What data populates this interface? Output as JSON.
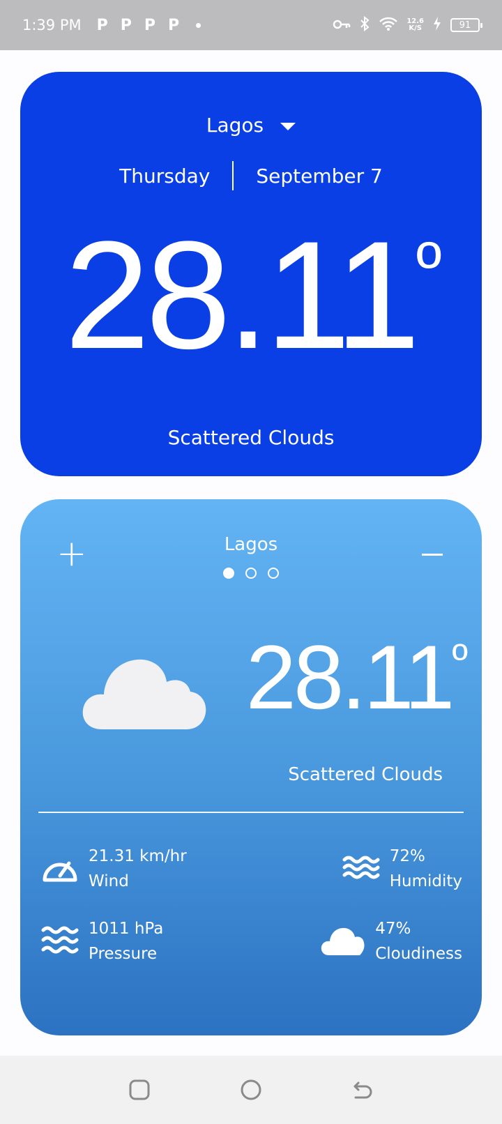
{
  "status_bar": {
    "time": "1:39 PM",
    "notification_icons": [
      "P",
      "P",
      "P",
      "P"
    ],
    "net_speed_value": "12.6",
    "net_speed_unit": "K/S",
    "battery": "91"
  },
  "main_card": {
    "city": "Lagos",
    "day": "Thursday",
    "date": "September 7",
    "temperature": "28.11",
    "degree_symbol": "º",
    "condition": "Scattered Clouds",
    "background_color": "#0a3fe6"
  },
  "detail_card": {
    "add_label": "+",
    "city": "Lagos",
    "page_count": 3,
    "active_page": 0,
    "temperature": "28.11",
    "degree_symbol": "º",
    "condition": "Scattered Clouds",
    "metrics": {
      "wind": {
        "value": "21.31 km/hr",
        "label": "Wind",
        "icon": "speedometer-icon"
      },
      "humidity": {
        "value": "72%",
        "label": "Humidity",
        "icon": "waves-icon"
      },
      "pressure": {
        "value": "1011 hPa",
        "label": "Pressure",
        "icon": "waves-icon"
      },
      "cloudiness": {
        "value": "47%",
        "label": "Cloudiness",
        "icon": "cloud-icon"
      }
    }
  },
  "nav_bar": {
    "buttons": [
      "recents",
      "home",
      "back"
    ]
  }
}
